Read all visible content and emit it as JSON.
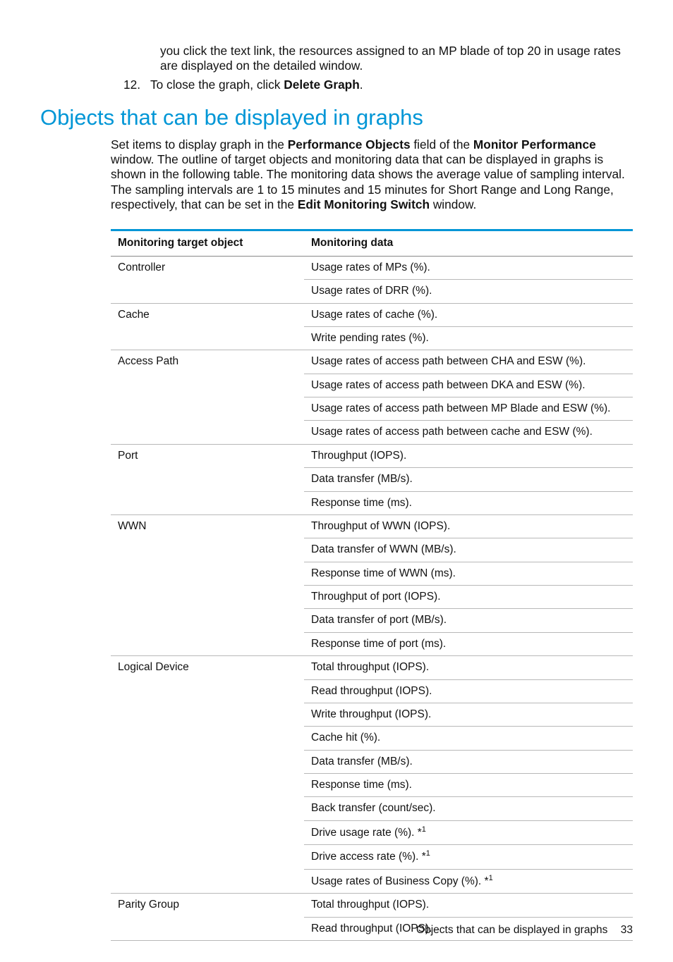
{
  "top": {
    "cont_line1": "you click the text link, the resources assigned to an MP blade of top 20 in usage rates",
    "cont_line2": "are displayed on the detailed window.",
    "item12_num": "12.",
    "item12_pre": "To close the graph, click ",
    "item12_bold": "Delete Graph",
    "item12_post": "."
  },
  "section_heading": "Objects that can be displayed in graphs",
  "intro": {
    "t1a": "Set items to display graph in the ",
    "t1b": "Performance Objects",
    "t1c": " field of the ",
    "t1d": "Monitor Performance",
    "t1e": " window.",
    "t2": "The outline of target objects and monitoring data that can be displayed in graphs is shown in the following table. The monitoring data shows the average value of sampling interval. The sampling intervals are 1 to 15 minutes and 15 minutes for Short Range and Long Range, respectively, that can be set in the ",
    "t2b": "Edit Monitoring Switch",
    "t2c": " window."
  },
  "table": {
    "head_obj": "Monitoring target object",
    "head_data": "Monitoring data",
    "rows": [
      {
        "obj": "Controller",
        "vals": [
          "Usage rates of MPs (%).",
          "Usage rates of DRR (%)."
        ]
      },
      {
        "obj": "Cache",
        "vals": [
          "Usage rates of cache (%).",
          "Write pending rates (%)."
        ]
      },
      {
        "obj": "Access Path",
        "vals": [
          "Usage rates of access path between CHA and ESW (%).",
          "Usage rates of access path between DKA and ESW (%).",
          "Usage rates of access path between MP Blade and ESW (%).",
          "Usage rates of access path between cache and ESW (%)."
        ]
      },
      {
        "obj": "Port",
        "vals": [
          "Throughput (IOPS).",
          "Data transfer (MB/s).",
          "Response time (ms)."
        ]
      },
      {
        "obj": "WWN",
        "vals": [
          "Throughput of WWN (IOPS).",
          "Data transfer of WWN (MB/s).",
          "Response time of WWN (ms).",
          "Throughput of port (IOPS).",
          "Data transfer of port (MB/s).",
          "Response time of port (ms)."
        ]
      },
      {
        "obj": "Logical Device",
        "vals": [
          "Total throughput (IOPS).",
          "Read throughput (IOPS).",
          "Write throughput (IOPS).",
          "Cache hit (%).",
          "Data transfer (MB/s).",
          "Response time (ms).",
          "Back transfer (count/sec).",
          {
            "text": "Drive usage rate (%). *",
            "sup": "1"
          },
          {
            "text": "Drive access rate (%). *",
            "sup": "1"
          },
          {
            "text": "Usage rates of Business Copy (%). *",
            "sup": "1"
          }
        ]
      },
      {
        "obj": "Parity Group",
        "vals": [
          "Total throughput (IOPS).",
          "Read throughput (IOPS)."
        ]
      }
    ]
  },
  "footer": {
    "label": "Objects that can be displayed in graphs",
    "page": "33"
  }
}
